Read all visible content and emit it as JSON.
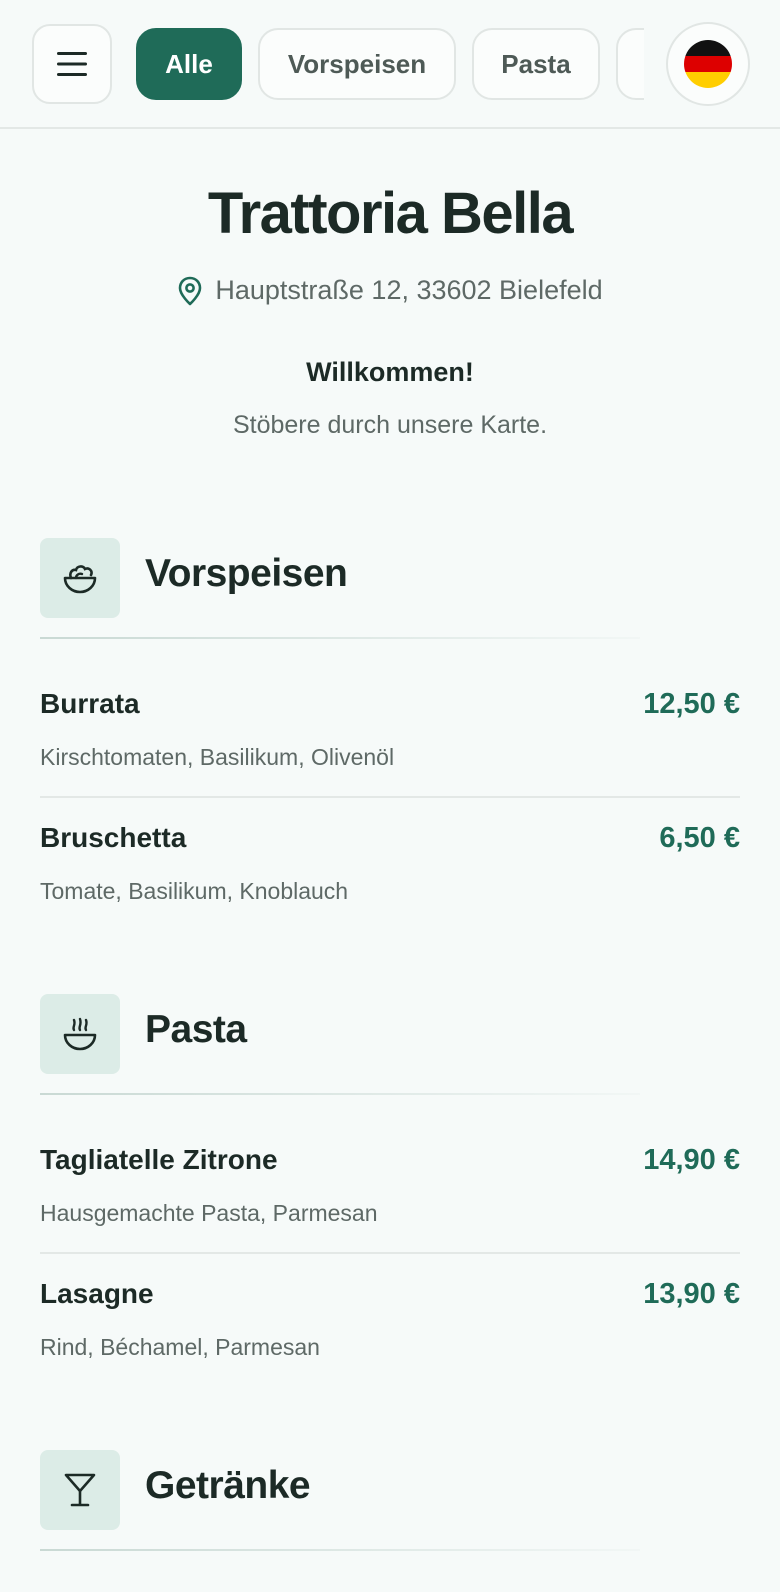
{
  "header": {
    "tabs": [
      {
        "label": "Alle",
        "active": true
      },
      {
        "label": "Vorspeisen",
        "active": false
      },
      {
        "label": "Pasta",
        "active": false
      }
    ],
    "language_flag": "german-flag-icon"
  },
  "restaurant": {
    "name": "Trattoria Bella",
    "address": "Hauptstraße 12, 33602 Bielefeld",
    "welcome": "Willkommen!",
    "subtitle": "Stöbere durch unsere Karte."
  },
  "sections": [
    {
      "title": "Vorspeisen",
      "icon": "salad-bowl-icon",
      "items": [
        {
          "name": "Burrata",
          "price": "12,50 €",
          "description": "Kirschtomaten, Basilikum, Olivenöl"
        },
        {
          "name": "Bruschetta",
          "price": "6,50 €",
          "description": "Tomate, Basilikum, Knoblauch"
        }
      ]
    },
    {
      "title": "Pasta",
      "icon": "steaming-bowl-icon",
      "items": [
        {
          "name": "Tagliatelle Zitrone",
          "price": "14,90 €",
          "description": "Hausgemachte Pasta, Parmesan"
        },
        {
          "name": "Lasagne",
          "price": "13,90 €",
          "description": "Rind, Béchamel, Parmesan"
        }
      ]
    },
    {
      "title": "Getränke",
      "icon": "cocktail-glass-icon",
      "items": []
    }
  ],
  "colors": {
    "accent": "#1f6b58",
    "background": "#f6faf9",
    "text": "#1c2a26",
    "muted": "#5e6966",
    "icon_bg": "#dcece7"
  }
}
